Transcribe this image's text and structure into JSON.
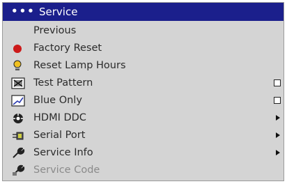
{
  "menu": {
    "title": "Service",
    "dots": "•••",
    "items": [
      {
        "label": "Previous",
        "icon": "none"
      },
      {
        "label": "Factory Reset",
        "icon": "red-circle-icon"
      },
      {
        "label": "Reset Lamp Hours",
        "icon": "lamp-bulb-icon"
      },
      {
        "label": "Test Pattern",
        "icon": "test-pattern-icon"
      },
      {
        "label": "Blue Only",
        "icon": "blue-only-icon"
      },
      {
        "label": "HDMI DDC",
        "icon": "hdmi-ddc-icon"
      },
      {
        "label": "Serial Port",
        "icon": "serial-port-icon"
      },
      {
        "label": "Service Info",
        "icon": "wrench-icon"
      },
      {
        "label": "Service Code",
        "icon": "wrench-lock-icon"
      }
    ]
  },
  "colors": {
    "title_bar": "#1b1f8c",
    "menu_bg": "#d4d4d4",
    "factory_reset_icon": "#cc1a1a"
  }
}
